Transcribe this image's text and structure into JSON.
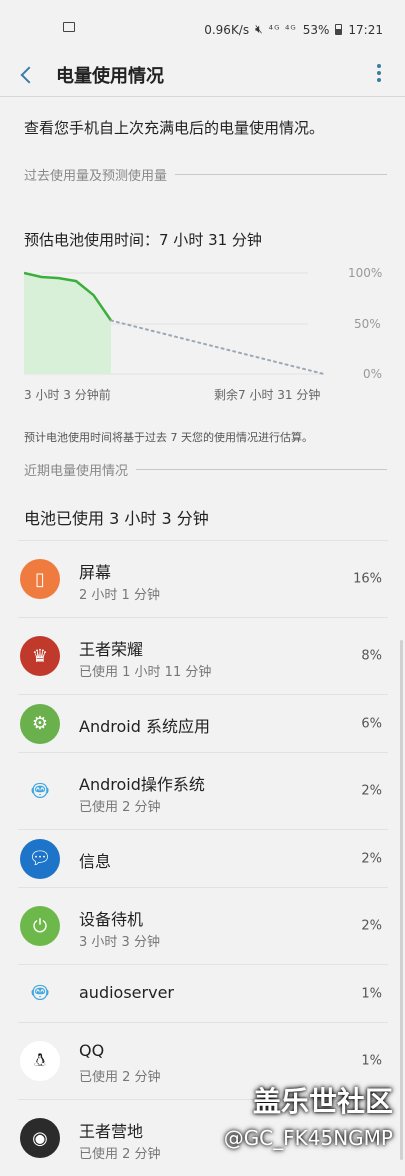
{
  "status": {
    "speed": "0.96K/s",
    "signal": "⁴ᴳ ⁴ᴳ",
    "battery": "53%",
    "time": "17:21"
  },
  "header": {
    "title": "电量使用情况"
  },
  "intro": "查看您手机自上次充满电后的电量使用情况。",
  "past_section": "过去使用量及预测使用量",
  "estimate": "预估电池使用时间：7 小时 31 分钟",
  "chart_data": {
    "type": "line",
    "y_ticks": [
      "100%",
      "50%",
      "0%"
    ],
    "x_labels": [
      "3 小时 3 分钟前",
      "剩余7 小时 31 分钟"
    ],
    "used_fraction": 0.29,
    "battery_start": 100,
    "battery_now": 53,
    "series": [
      {
        "values": [
          100,
          96,
          95,
          92,
          78,
          53
        ]
      },
      {
        "values": [
          53,
          0
        ]
      }
    ],
    "ylim": [
      0,
      100
    ],
    "colors": {
      "actual": "#3cae3c",
      "predicted": "#9ba8b8",
      "fill": "#d8f0d8"
    }
  },
  "note": "预计电池使用时间将基于过去 7 天您的使用情况进行估算。",
  "recent_section": "近期电量使用情况",
  "used_label": "电池已使用 3 小时 3 分钟",
  "apps": [
    {
      "name": "屏幕",
      "sub": "2 小时 1 分钟",
      "pct": "16%",
      "icon": "screen-icon",
      "color": "#f07b3f"
    },
    {
      "name": "王者荣耀",
      "sub": "已使用 1 小时 11 分钟",
      "pct": "8%",
      "icon": "game-hero-icon",
      "color": "#c0392b"
    },
    {
      "name": "Android 系统应用",
      "sub": "",
      "pct": "6%",
      "icon": "gear-icon",
      "color": "#6ab04c"
    },
    {
      "name": "Android操作系统",
      "sub": "已使用 2 分钟",
      "pct": "2%",
      "icon": "android-icon",
      "color": "#3fa7e0"
    },
    {
      "name": "信息",
      "sub": "",
      "pct": "2%",
      "icon": "message-icon",
      "color": "#1e74c8"
    },
    {
      "name": "设备待机",
      "sub": "3 小时 3 分钟",
      "pct": "2%",
      "icon": "power-icon",
      "color": "#6cb84a"
    },
    {
      "name": "audioserver",
      "sub": "",
      "pct": "1%",
      "icon": "android-icon",
      "color": "#3fa7e0"
    },
    {
      "name": "QQ",
      "sub": "已使用 2 分钟",
      "pct": "1%",
      "icon": "penguin-icon",
      "color": "#111111"
    },
    {
      "name": "王者营地",
      "sub": "已使用 2 分钟",
      "pct": "",
      "icon": "camp-icon",
      "color": "#2b2b2b"
    }
  ],
  "watermark": {
    "line1": "盖乐世社区",
    "line2": "@GC_FK45NGMP"
  }
}
